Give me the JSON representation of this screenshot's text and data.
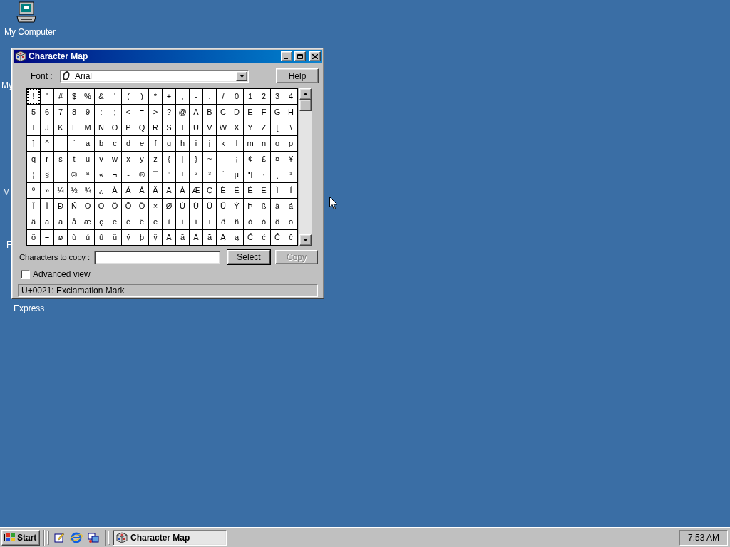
{
  "desktop_icons": [
    {
      "label": "My Computer",
      "kind": "computer"
    },
    {
      "label": "My",
      "kind": "hidden"
    },
    {
      "label": "M",
      "kind": "hidden"
    },
    {
      "label": "F",
      "kind": "hidden"
    },
    {
      "label": "Express",
      "kind": "hidden"
    }
  ],
  "window": {
    "title": "Character Map",
    "active": true
  },
  "font": {
    "label": "Font :",
    "value": "Arial"
  },
  "help_button": "Help",
  "grid": {
    "rows": [
      [
        {
          "char": "!",
          "selected": true
        },
        {
          "char": "\"",
          "selected": false
        },
        {
          "char": "#",
          "selected": false
        },
        {
          "char": "$",
          "selected": false
        },
        {
          "char": "%",
          "selected": false
        },
        {
          "char": "&",
          "selected": false
        },
        {
          "char": "'",
          "selected": false
        },
        {
          "char": "(",
          "selected": false
        },
        {
          "char": ")",
          "selected": false
        },
        {
          "char": "*",
          "selected": false
        },
        {
          "char": "+",
          "selected": false
        },
        {
          "char": ",",
          "selected": false
        },
        {
          "char": "-",
          "selected": false
        },
        {
          "char": ".",
          "selected": false
        },
        {
          "char": "/",
          "selected": false
        },
        {
          "char": "0",
          "selected": false
        },
        {
          "char": "1",
          "selected": false
        },
        {
          "char": "2",
          "selected": false
        },
        {
          "char": "3",
          "selected": false
        },
        {
          "char": "4",
          "selected": false
        }
      ],
      [
        {
          "char": "5",
          "selected": false
        },
        {
          "char": "6",
          "selected": false
        },
        {
          "char": "7",
          "selected": false
        },
        {
          "char": "8",
          "selected": false
        },
        {
          "char": "9",
          "selected": false
        },
        {
          "char": ":",
          "selected": false
        },
        {
          "char": ";",
          "selected": false
        },
        {
          "char": "<",
          "selected": false
        },
        {
          "char": "=",
          "selected": false
        },
        {
          "char": ">",
          "selected": false
        },
        {
          "char": "?",
          "selected": false
        },
        {
          "char": "@",
          "selected": false
        },
        {
          "char": "A",
          "selected": false
        },
        {
          "char": "B",
          "selected": false
        },
        {
          "char": "C",
          "selected": false
        },
        {
          "char": "D",
          "selected": false
        },
        {
          "char": "E",
          "selected": false
        },
        {
          "char": "F",
          "selected": false
        },
        {
          "char": "G",
          "selected": false
        },
        {
          "char": "H",
          "selected": false
        }
      ],
      [
        {
          "char": "I",
          "selected": false
        },
        {
          "char": "J",
          "selected": false
        },
        {
          "char": "K",
          "selected": false
        },
        {
          "char": "L",
          "selected": false
        },
        {
          "char": "M",
          "selected": false
        },
        {
          "char": "N",
          "selected": false
        },
        {
          "char": "O",
          "selected": false
        },
        {
          "char": "P",
          "selected": false
        },
        {
          "char": "Q",
          "selected": false
        },
        {
          "char": "R",
          "selected": false
        },
        {
          "char": "S",
          "selected": false
        },
        {
          "char": "T",
          "selected": false
        },
        {
          "char": "U",
          "selected": false
        },
        {
          "char": "V",
          "selected": false
        },
        {
          "char": "W",
          "selected": false
        },
        {
          "char": "X",
          "selected": false
        },
        {
          "char": "Y",
          "selected": false
        },
        {
          "char": "Z",
          "selected": false
        },
        {
          "char": "[",
          "selected": false
        },
        {
          "char": "\\",
          "selected": false
        }
      ],
      [
        {
          "char": "]",
          "selected": false
        },
        {
          "char": "^",
          "selected": false
        },
        {
          "char": "_",
          "selected": false
        },
        {
          "char": "`",
          "selected": false
        },
        {
          "char": "a",
          "selected": false
        },
        {
          "char": "b",
          "selected": false
        },
        {
          "char": "c",
          "selected": false
        },
        {
          "char": "d",
          "selected": false
        },
        {
          "char": "e",
          "selected": false
        },
        {
          "char": "f",
          "selected": false
        },
        {
          "char": "g",
          "selected": false
        },
        {
          "char": "h",
          "selected": false
        },
        {
          "char": "i",
          "selected": false
        },
        {
          "char": "j",
          "selected": false
        },
        {
          "char": "k",
          "selected": false
        },
        {
          "char": "l",
          "selected": false
        },
        {
          "char": "m",
          "selected": false
        },
        {
          "char": "n",
          "selected": false
        },
        {
          "char": "o",
          "selected": false
        },
        {
          "char": "p",
          "selected": false
        }
      ],
      [
        {
          "char": "q",
          "selected": false
        },
        {
          "char": "r",
          "selected": false
        },
        {
          "char": "s",
          "selected": false
        },
        {
          "char": "t",
          "selected": false
        },
        {
          "char": "u",
          "selected": false
        },
        {
          "char": "v",
          "selected": false
        },
        {
          "char": "w",
          "selected": false
        },
        {
          "char": "x",
          "selected": false
        },
        {
          "char": "y",
          "selected": false
        },
        {
          "char": "z",
          "selected": false
        },
        {
          "char": "{",
          "selected": false
        },
        {
          "char": "|",
          "selected": false
        },
        {
          "char": "}",
          "selected": false
        },
        {
          "char": "~",
          "selected": false
        },
        {
          "selected": false
        },
        {
          "char": "¡",
          "selected": false
        },
        {
          "char": "¢",
          "selected": false
        },
        {
          "char": "£",
          "selected": false
        },
        {
          "char": "¤",
          "selected": false
        },
        {
          "char": "¥",
          "selected": false
        }
      ],
      [
        {
          "char": "¦",
          "selected": false
        },
        {
          "char": "§",
          "selected": false
        },
        {
          "char": "¨",
          "selected": false
        },
        {
          "char": "©",
          "selected": false
        },
        {
          "char": "ª",
          "selected": false
        },
        {
          "char": "«",
          "selected": false
        },
        {
          "char": "¬",
          "selected": false
        },
        {
          "char": "-",
          "selected": false
        },
        {
          "char": "®",
          "selected": false
        },
        {
          "char": "¯",
          "selected": false
        },
        {
          "char": "°",
          "selected": false
        },
        {
          "char": "±",
          "selected": false
        },
        {
          "char": "²",
          "selected": false
        },
        {
          "char": "³",
          "selected": false
        },
        {
          "char": "´",
          "selected": false
        },
        {
          "char": "µ",
          "selected": false
        },
        {
          "char": "¶",
          "selected": false
        },
        {
          "char": "·",
          "selected": false
        },
        {
          "char": "¸",
          "selected": false
        },
        {
          "char": "¹",
          "selected": false
        }
      ],
      [
        {
          "char": "º",
          "selected": false
        },
        {
          "char": "»",
          "selected": false
        },
        {
          "char": "¼",
          "selected": false
        },
        {
          "char": "½",
          "selected": false
        },
        {
          "char": "¾",
          "selected": false
        },
        {
          "char": "¿",
          "selected": false
        },
        {
          "char": "À",
          "selected": false
        },
        {
          "char": "Á",
          "selected": false
        },
        {
          "char": "Â",
          "selected": false
        },
        {
          "char": "Ã",
          "selected": false
        },
        {
          "char": "Ä",
          "selected": false
        },
        {
          "char": "Å",
          "selected": false
        },
        {
          "char": "Æ",
          "selected": false
        },
        {
          "char": "Ç",
          "selected": false
        },
        {
          "char": "È",
          "selected": false
        },
        {
          "char": "É",
          "selected": false
        },
        {
          "char": "Ê",
          "selected": false
        },
        {
          "char": "Ë",
          "selected": false
        },
        {
          "char": "Ì",
          "selected": false
        },
        {
          "char": "Í",
          "selected": false
        }
      ],
      [
        {
          "char": "Î",
          "selected": false
        },
        {
          "char": "Ï",
          "selected": false
        },
        {
          "char": "Ð",
          "selected": false
        },
        {
          "char": "Ñ",
          "selected": false
        },
        {
          "char": "Ò",
          "selected": false
        },
        {
          "char": "Ó",
          "selected": false
        },
        {
          "char": "Ô",
          "selected": false
        },
        {
          "char": "Õ",
          "selected": false
        },
        {
          "char": "Ö",
          "selected": false
        },
        {
          "char": "×",
          "selected": false
        },
        {
          "char": "Ø",
          "selected": false
        },
        {
          "char": "Ù",
          "selected": false
        },
        {
          "char": "Ú",
          "selected": false
        },
        {
          "char": "Û",
          "selected": false
        },
        {
          "char": "Ü",
          "selected": false
        },
        {
          "char": "Ý",
          "selected": false
        },
        {
          "char": "Þ",
          "selected": false
        },
        {
          "char": "ß",
          "selected": false
        },
        {
          "char": "à",
          "selected": false
        },
        {
          "char": "á",
          "selected": false
        }
      ],
      [
        {
          "char": "â",
          "selected": false
        },
        {
          "char": "ã",
          "selected": false
        },
        {
          "char": "ä",
          "selected": false
        },
        {
          "char": "å",
          "selected": false
        },
        {
          "char": "æ",
          "selected": false
        },
        {
          "char": "ç",
          "selected": false
        },
        {
          "char": "è",
          "selected": false
        },
        {
          "char": "é",
          "selected": false
        },
        {
          "char": "ê",
          "selected": false
        },
        {
          "char": "ë",
          "selected": false
        },
        {
          "char": "ì",
          "selected": false
        },
        {
          "char": "í",
          "selected": false
        },
        {
          "char": "î",
          "selected": false
        },
        {
          "char": "ï",
          "selected": false
        },
        {
          "char": "ð",
          "selected": false
        },
        {
          "char": "ñ",
          "selected": false
        },
        {
          "char": "ò",
          "selected": false
        },
        {
          "char": "ó",
          "selected": false
        },
        {
          "char": "ô",
          "selected": false
        },
        {
          "char": "õ",
          "selected": false
        }
      ],
      [
        {
          "char": "ö",
          "selected": false
        },
        {
          "char": "÷",
          "selected": false
        },
        {
          "char": "ø",
          "selected": false
        },
        {
          "char": "ù",
          "selected": false
        },
        {
          "char": "ú",
          "selected": false
        },
        {
          "char": "û",
          "selected": false
        },
        {
          "char": "ü",
          "selected": false
        },
        {
          "char": "ý",
          "selected": false
        },
        {
          "char": "þ",
          "selected": false
        },
        {
          "char": "ÿ",
          "selected": false
        },
        {
          "char": "Ā",
          "selected": false
        },
        {
          "char": "ā",
          "selected": false
        },
        {
          "char": "Ă",
          "selected": false
        },
        {
          "char": "ă",
          "selected": false
        },
        {
          "char": "Ą",
          "selected": false
        },
        {
          "char": "ą",
          "selected": false
        },
        {
          "char": "Ć",
          "selected": false
        },
        {
          "char": "ć",
          "selected": false
        },
        {
          "char": "Ĉ",
          "selected": false
        },
        {
          "char": "ĉ",
          "selected": false
        }
      ]
    ]
  },
  "copy_row": {
    "label": "Characters to copy :",
    "select_button": {
      "label": "Select",
      "disabled": false
    },
    "copy_button": {
      "label": "Copy",
      "disabled": true
    }
  },
  "advanced_view": {
    "label": "Advanced view",
    "checked": false
  },
  "status_bar": "U+0021: Exclamation Mark",
  "taskbar": {
    "start": "Start",
    "tasks": [
      {
        "label": "Character Map",
        "selected": true
      }
    ],
    "clock": "7:53 AM"
  }
}
